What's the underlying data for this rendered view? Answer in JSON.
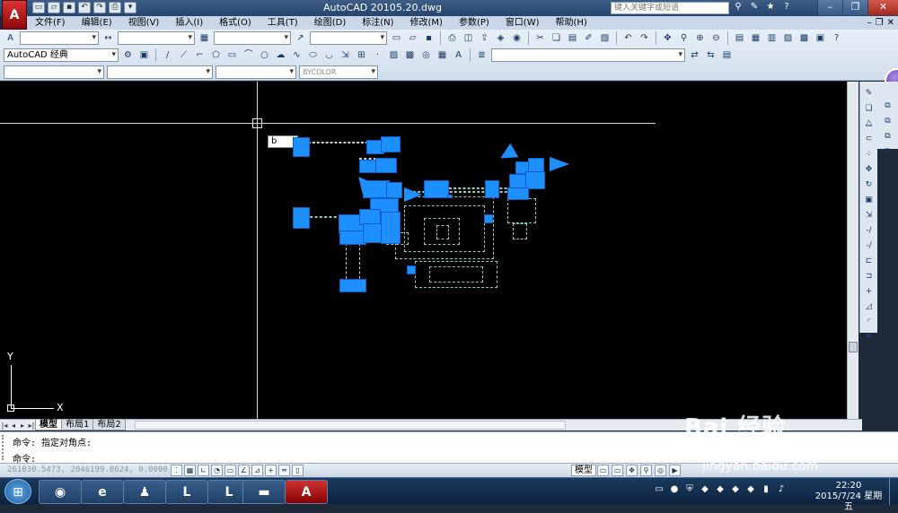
{
  "window": {
    "app_title": "AutoCAD 2010",
    "file_name": "5.20.dwg",
    "search_placeholder": "键入关键字或短语"
  },
  "menubar": {
    "items": [
      "文件(F)",
      "编辑(E)",
      "视图(V)",
      "插入(I)",
      "格式(O)",
      "工具(T)",
      "绘图(D)",
      "标注(N)",
      "修改(M)",
      "参数(P)",
      "窗口(W)",
      "帮助(H)"
    ]
  },
  "toolbars": {
    "workspace": "AutoCAD 经典",
    "lineweight": "BYCOLOR"
  },
  "canvas": {
    "dynamic_input_value": "b",
    "ucs_x_label": "X",
    "ucs_y_label": "Y"
  },
  "layout_tabs": [
    "模型",
    "布局1",
    "布局2"
  ],
  "command_line": {
    "history": "命令: 指定对角点:",
    "prompt": "命令:"
  },
  "status": {
    "coordinates": "261030.5473, 2046199.8624, 0.0000",
    "model_button": "模型"
  },
  "taskbar": {
    "time": "22:20",
    "date": "2015/7/24 星期五"
  },
  "watermark": {
    "brand": "Bai 经验",
    "site": "jingyan.baidu.com"
  },
  "colors": {
    "canvas_bg": "#000000",
    "grip_blue": "#1e8fff",
    "dashed_cyan": "#8fd0c4"
  }
}
